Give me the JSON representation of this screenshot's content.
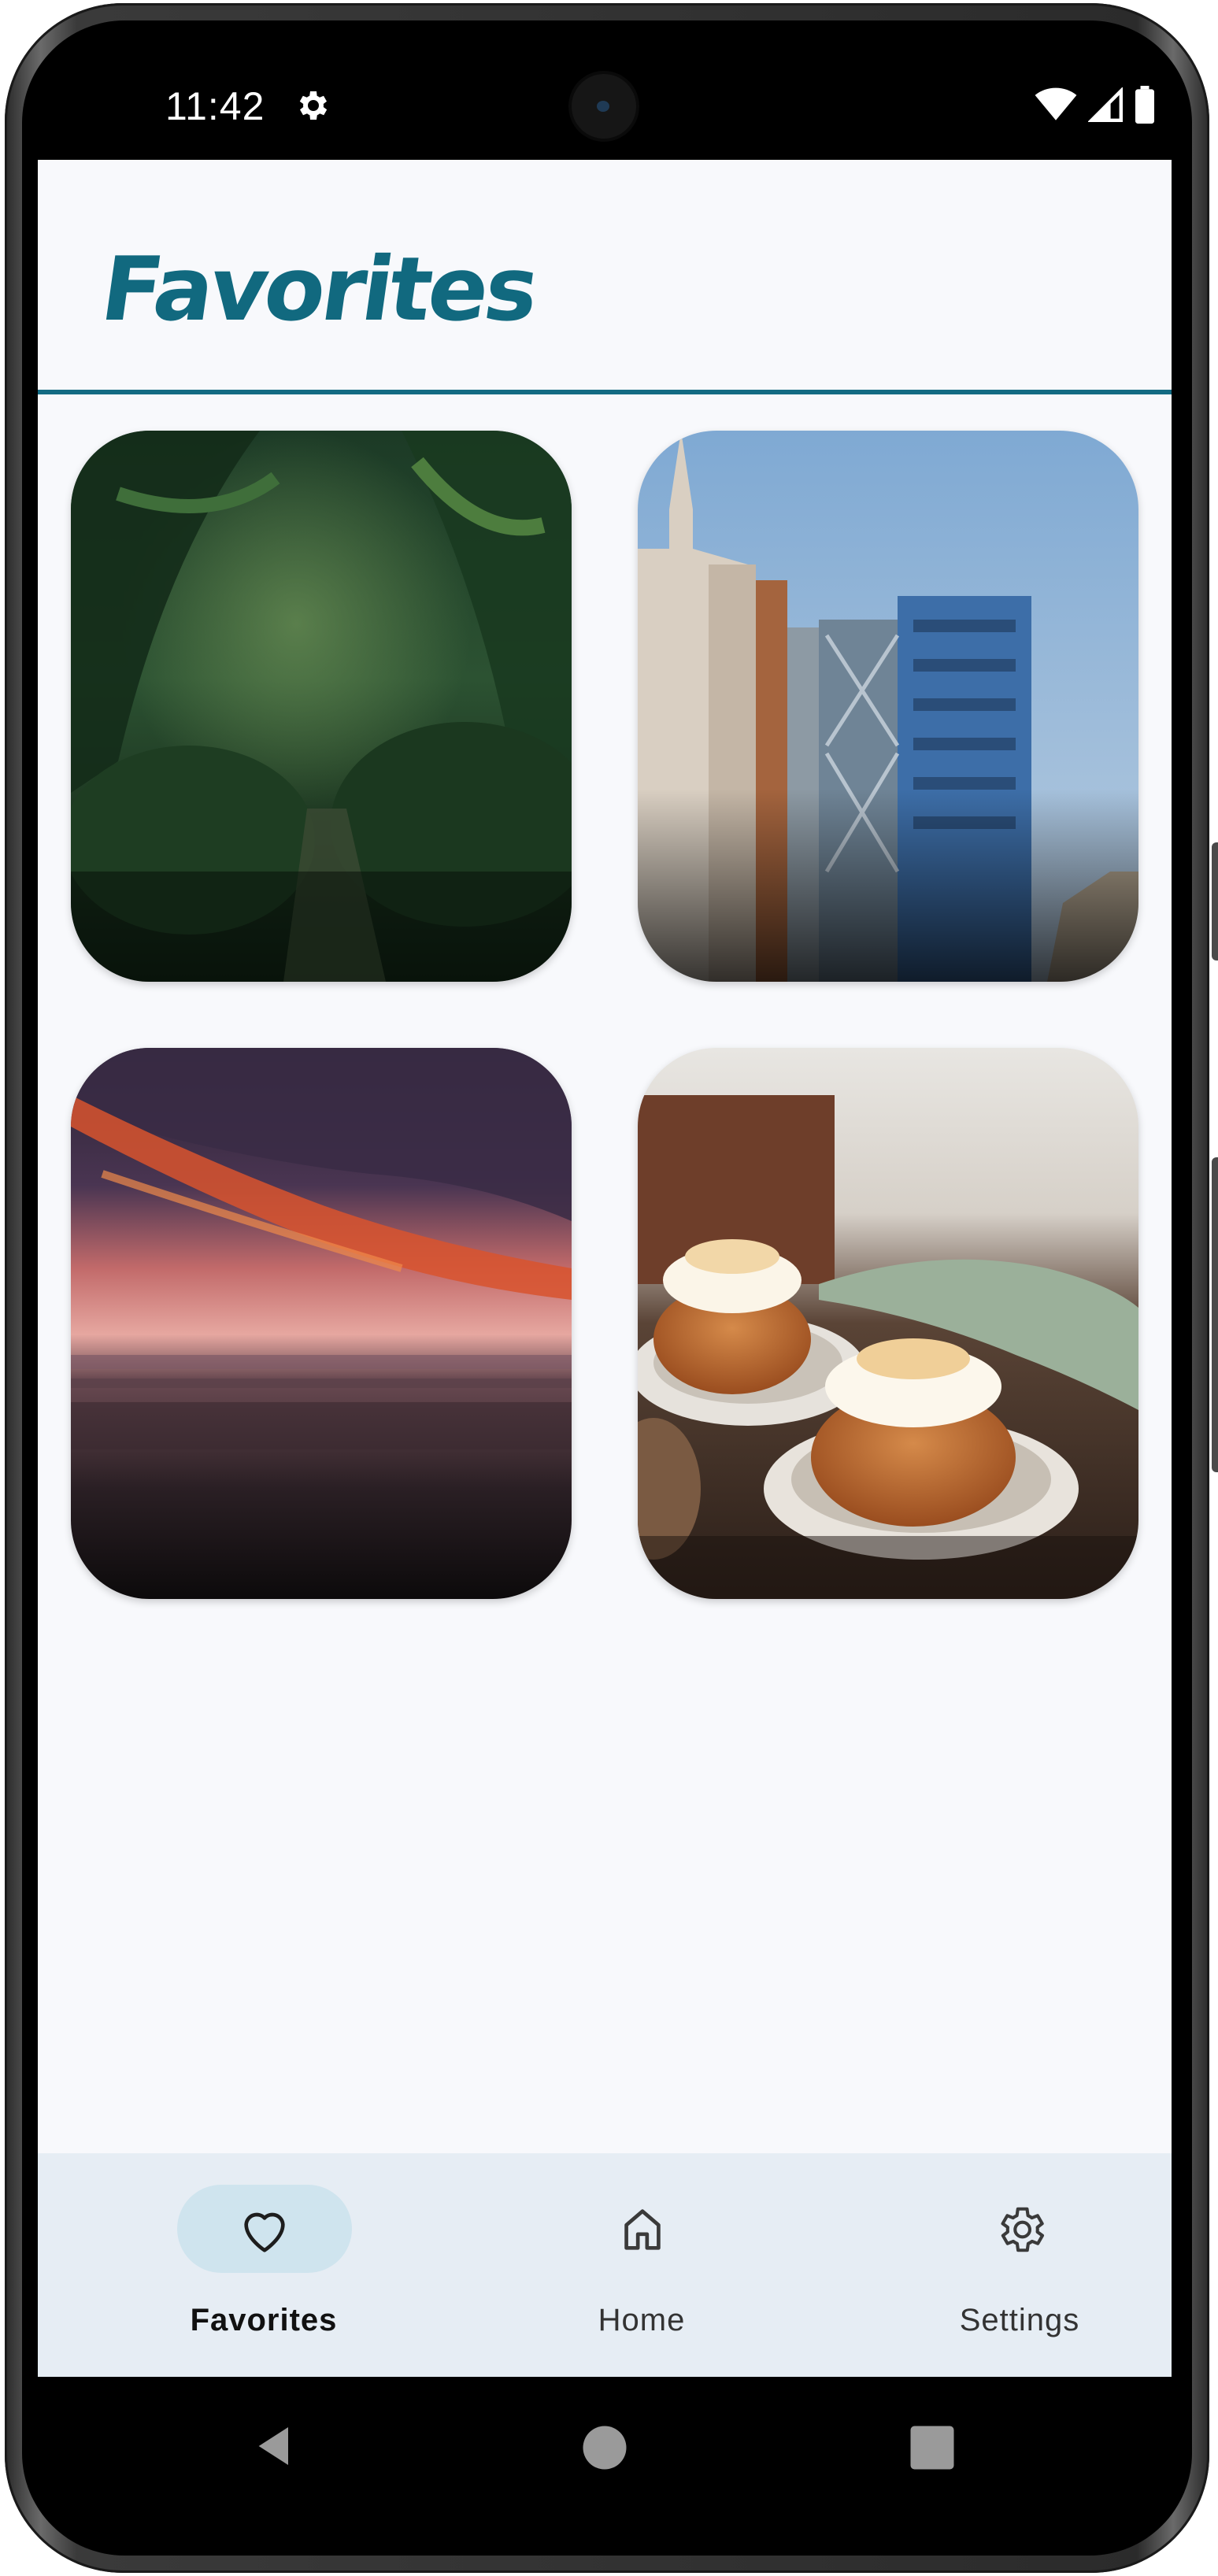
{
  "status_bar": {
    "time": "11:42",
    "icons": [
      "settings-icon",
      "wifi-icon",
      "signal-icon",
      "battery-icon"
    ]
  },
  "header": {
    "title": "Favorites"
  },
  "favorites": {
    "items": [
      {
        "subject": "jungle-path-photo"
      },
      {
        "subject": "buildings-photo"
      },
      {
        "subject": "sunset-beach-photo"
      },
      {
        "subject": "cream-buns-photo"
      }
    ]
  },
  "bottom_nav": {
    "items": [
      {
        "label": "Favorites",
        "icon": "heart-icon",
        "active": true
      },
      {
        "label": "Home",
        "icon": "home-icon",
        "active": false
      },
      {
        "label": "Settings",
        "icon": "gear-icon",
        "active": false
      }
    ]
  },
  "system_nav": {
    "buttons": [
      "back-button",
      "home-button",
      "recents-button"
    ]
  },
  "colors": {
    "accent": "#136b83",
    "background": "#f8f9fc",
    "nav_background": "#e6edf4",
    "active_pill": "#cfe4ee"
  }
}
